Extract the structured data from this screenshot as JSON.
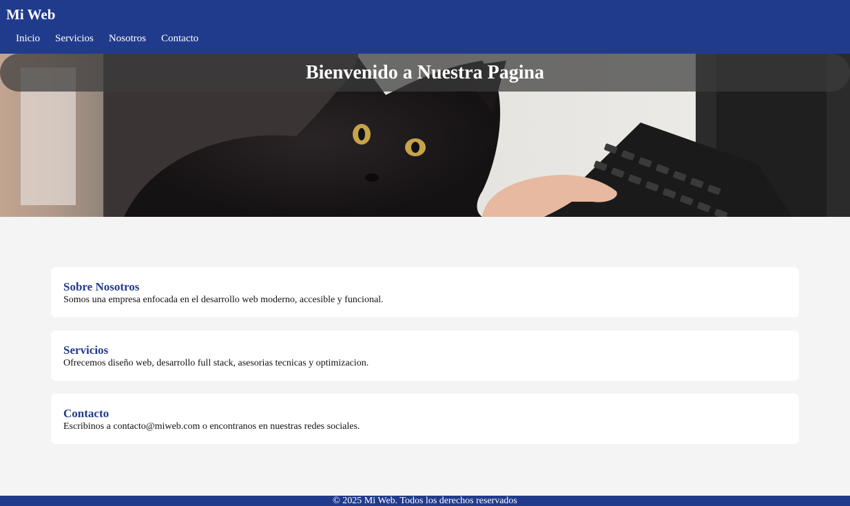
{
  "header": {
    "logo": "Mi Web",
    "nav": [
      "Inicio",
      "Servicios",
      "Nosotros",
      "Contacto"
    ]
  },
  "hero": {
    "title": "Bienvenido a Nuestra Pagina",
    "image": "black-cat-on-keyboard-photo"
  },
  "sections": [
    {
      "title": "Sobre Nosotros",
      "text": "Somos una empresa enfocada en el desarrollo web moderno, accesible y funcional."
    },
    {
      "title": "Servicios",
      "text": "Ofrecemos diseño web, desarrollo full stack, asesorias tecnicas y optimizacion."
    },
    {
      "title": "Contacto",
      "text": "Escribinos a contacto@miweb.com o encontranos en nuestras redes sociales."
    }
  ],
  "footer": {
    "text": "© 2025 Mi Web. Todos los derechos reservados"
  },
  "colors": {
    "primary": "#213b8c",
    "background": "#f4f4f4",
    "card": "#ffffff"
  }
}
